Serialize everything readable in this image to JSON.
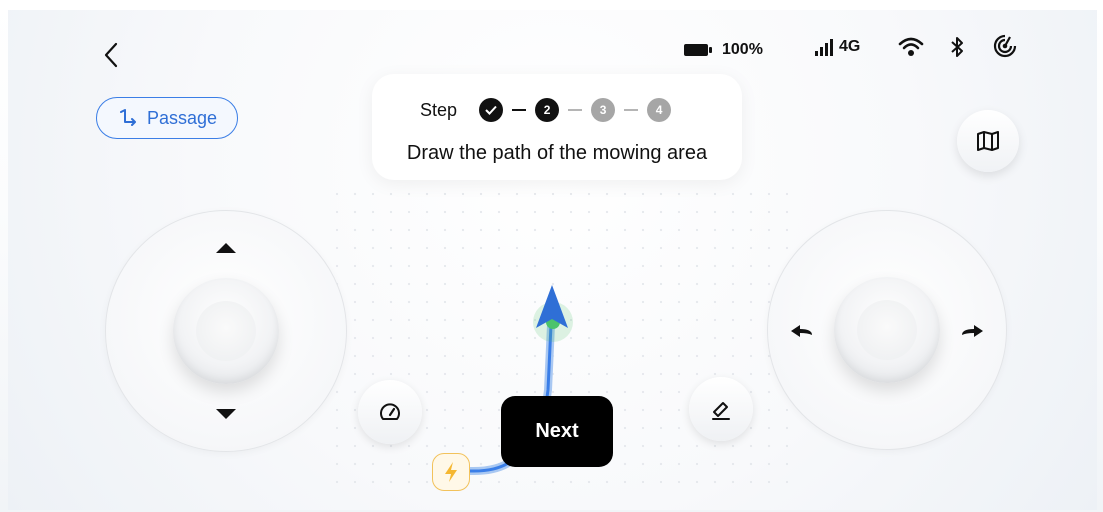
{
  "status_bar": {
    "battery_text": "100%",
    "network_text": "4G",
    "icons": [
      "battery-icon",
      "signal-icon",
      "wifi-icon",
      "bluetooth-icon",
      "radar-icon"
    ]
  },
  "nav": {
    "back_icon": "chevron-left-icon"
  },
  "passage": {
    "label": "Passage",
    "icon": "route-icon",
    "accent": "#3b7ee6"
  },
  "steps": {
    "label": "Step",
    "items": [
      {
        "text": "",
        "state": "done"
      },
      {
        "text": "2",
        "state": "active"
      },
      {
        "text": "3",
        "state": "inactive"
      },
      {
        "text": "4",
        "state": "inactive"
      }
    ],
    "instruction": "Draw the path of the mowing area"
  },
  "controls": {
    "map_icon": "map-icon",
    "speed_icon": "speedometer-icon",
    "eraser_icon": "eraser-icon",
    "charging_icon": "lightning-icon",
    "next_label": "Next"
  },
  "colors": {
    "path": "#3a7ee8",
    "path_light": "#a9c8f2",
    "marker_green": "#4cc36b",
    "charge_bg": "#fff8e8",
    "charge_border": "#f2c25b",
    "charge_bolt": "#f5b731"
  }
}
